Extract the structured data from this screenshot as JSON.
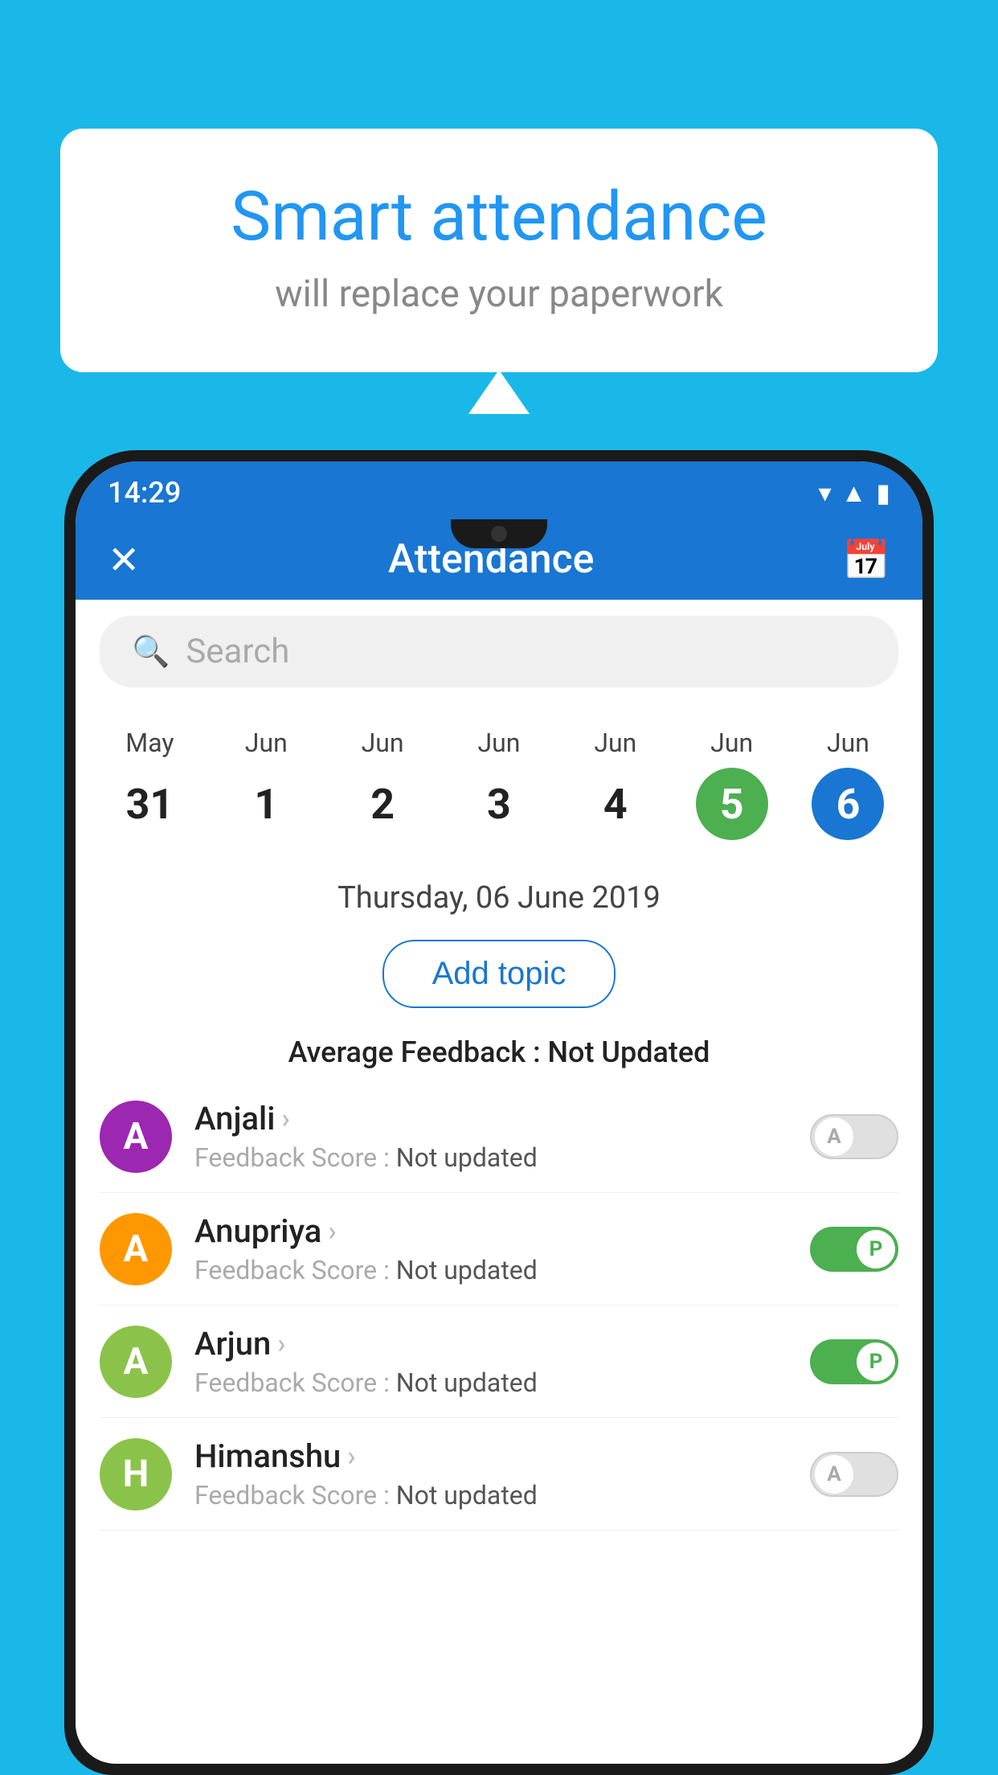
{
  "background_color": "#1ab8e8",
  "bubble": {
    "title": "Smart attendance",
    "subtitle": "will replace your paperwork"
  },
  "phone": {
    "status_bar": {
      "time": "14:29",
      "icons": [
        "wifi",
        "signal",
        "battery"
      ]
    },
    "app_bar": {
      "title": "Attendance",
      "close_label": "×",
      "calendar_label": "📅"
    },
    "search": {
      "placeholder": "Search"
    },
    "date_strip": [
      {
        "month": "May",
        "day": "31",
        "state": "normal"
      },
      {
        "month": "Jun",
        "day": "1",
        "state": "normal"
      },
      {
        "month": "Jun",
        "day": "2",
        "state": "normal"
      },
      {
        "month": "Jun",
        "day": "3",
        "state": "normal"
      },
      {
        "month": "Jun",
        "day": "4",
        "state": "normal"
      },
      {
        "month": "Jun",
        "day": "5",
        "state": "today"
      },
      {
        "month": "Jun",
        "day": "6",
        "state": "selected"
      }
    ],
    "selected_date": "Thursday, 06 June 2019",
    "add_topic_label": "Add topic",
    "avg_feedback_label": "Average Feedback :",
    "avg_feedback_value": "Not Updated",
    "students": [
      {
        "name": "Anjali",
        "feedback_label": "Feedback Score :",
        "feedback_value": "Not updated",
        "avatar_letter": "A",
        "avatar_color": "#9c27b0",
        "toggle_state": "off",
        "toggle_letter": "A"
      },
      {
        "name": "Anupriya",
        "feedback_label": "Feedback Score :",
        "feedback_value": "Not updated",
        "avatar_letter": "A",
        "avatar_color": "#ff9800",
        "toggle_state": "on",
        "toggle_letter": "P"
      },
      {
        "name": "Arjun",
        "feedback_label": "Feedback Score :",
        "feedback_value": "Not updated",
        "avatar_letter": "A",
        "avatar_color": "#8bc34a",
        "toggle_state": "on",
        "toggle_letter": "P"
      },
      {
        "name": "Himanshu",
        "feedback_label": "Feedback Score :",
        "feedback_value": "Not updated",
        "avatar_letter": "H",
        "avatar_color": "#8bc34a",
        "toggle_state": "off",
        "toggle_letter": "A"
      }
    ]
  }
}
